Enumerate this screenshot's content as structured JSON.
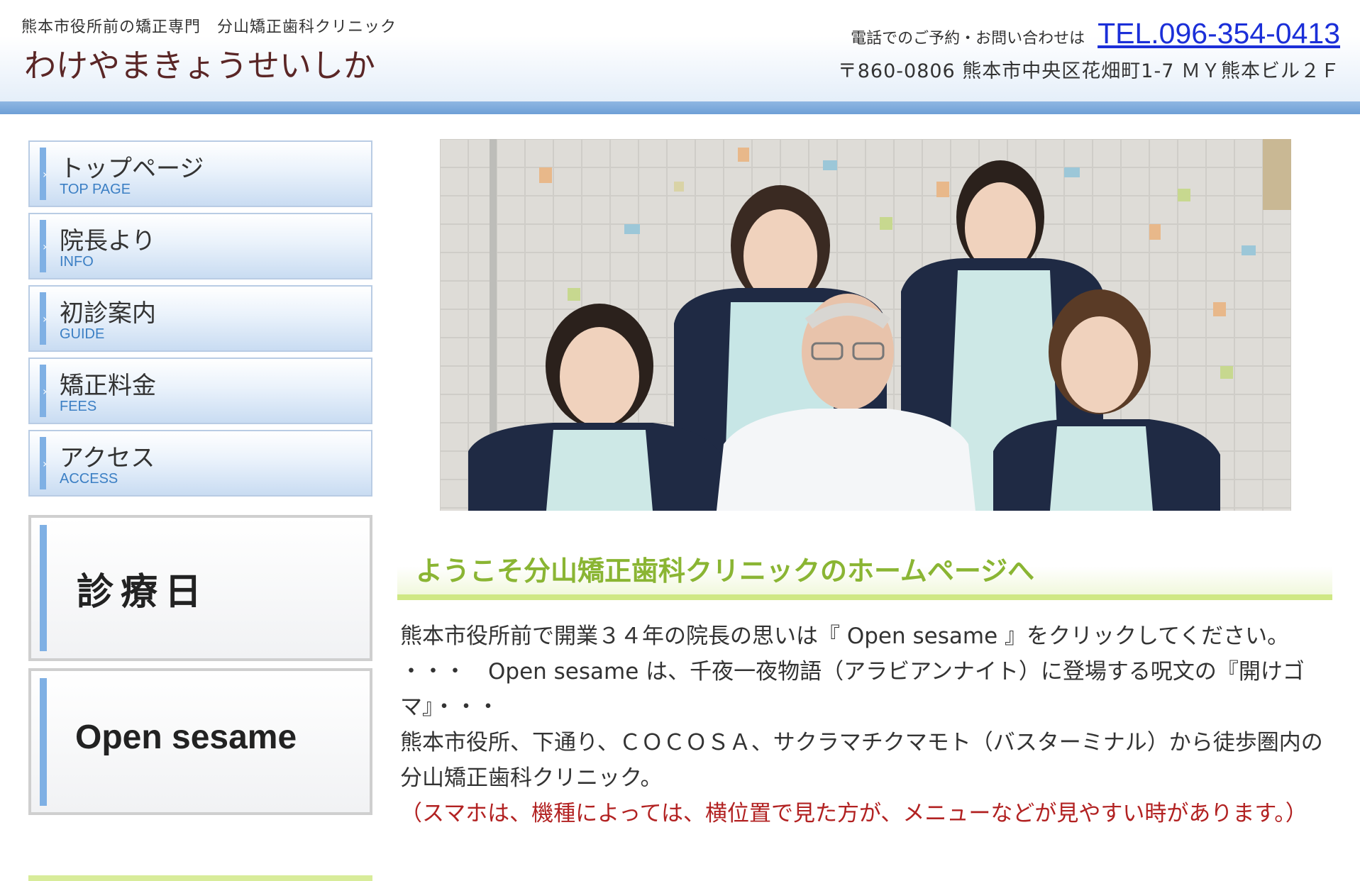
{
  "header": {
    "tagline": "熊本市役所前の矯正専門　分山矯正歯科クリニック",
    "logo": "わけやまきょうせいしか",
    "contact_label": "電話でのご予約・お問い合わせは",
    "tel": "TEL.096-354-0413",
    "address": "〒860-0806 熊本市中央区花畑町1-7 ＭＹ熊本ビル２Ｆ"
  },
  "nav": {
    "items": [
      {
        "jp": "トップページ",
        "en": "TOP PAGE"
      },
      {
        "jp": "院長より",
        "en": "INFO"
      },
      {
        "jp": "初診案内",
        "en": "GUIDE"
      },
      {
        "jp": "矯正料金",
        "en": "FEES"
      },
      {
        "jp": "アクセス",
        "en": "ACCESS"
      }
    ]
  },
  "banners": {
    "schedule": "診療日",
    "open_sesame": "Open sesame"
  },
  "main": {
    "welcome": "ようこそ分山矯正歯科クリニックのホームページへ",
    "paragraphs": [
      "熊本市役所前で開業３４年の院長の思いは『 Open sesame 』をクリックしてください。",
      "・・・　Open sesame は、千夜一夜物語（アラビアンナイト）に登場する呪文の『開けゴマ』・・・",
      "熊本市役所、下通り、ＣＯＣＯＳＡ、サクラマチクマモト（バスターミナル）から徒歩圏内の分山矯正歯科クリニック。"
    ],
    "notice": "（スマホは、機種によっては、横位置で見た方が、メニューなどが見やすい時があります。）"
  },
  "colors": {
    "accent_blue": "#7fb0e4",
    "welcome_green": "#8ab533",
    "notice_red": "#b22222",
    "tel_blue": "#1b2fd8",
    "logo_brown": "#5a2626"
  },
  "icons": [
    "chevron-right-icon"
  ]
}
